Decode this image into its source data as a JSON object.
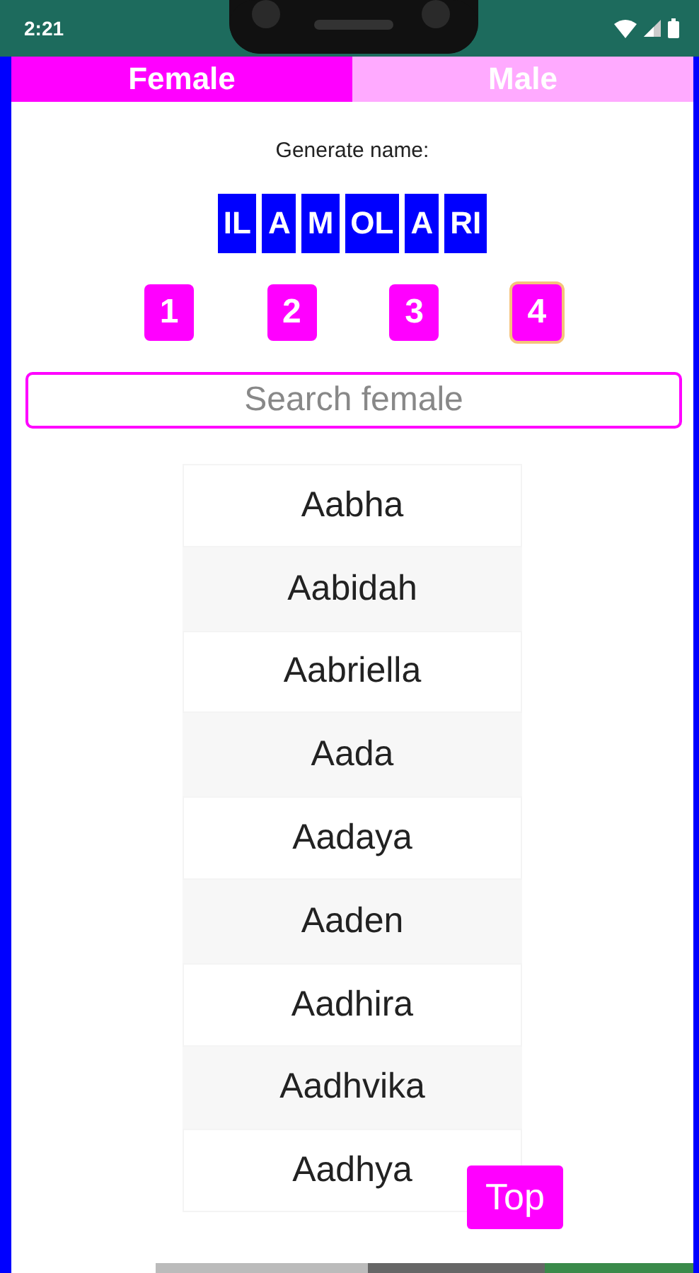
{
  "status_bar": {
    "time": "2:21"
  },
  "tabs": [
    {
      "label": "Female",
      "selected": true
    },
    {
      "label": "Male",
      "selected": false
    }
  ],
  "generator": {
    "label": "Generate name:",
    "syllables": [
      "IL",
      "A",
      "M",
      "OL",
      "A",
      "RI"
    ],
    "counts": [
      {
        "label": "1",
        "selected": false
      },
      {
        "label": "2",
        "selected": false
      },
      {
        "label": "3",
        "selected": false
      },
      {
        "label": "4",
        "selected": true
      }
    ]
  },
  "search": {
    "placeholder": "Search female"
  },
  "names": [
    "Aabha",
    "Aabidah",
    "Aabriella",
    "Aada",
    "Aadaya",
    "Aaden",
    "Aadhira",
    "Aadhvika",
    "Aadhya"
  ],
  "top_button": {
    "label": "Top"
  }
}
